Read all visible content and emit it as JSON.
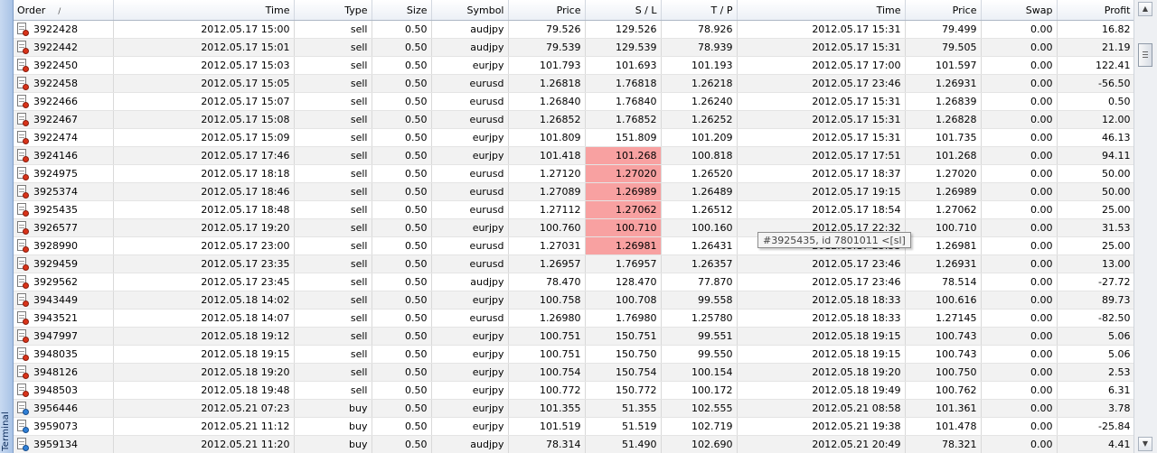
{
  "side_label": "Terminal",
  "columns": [
    "Order",
    "Time",
    "Type",
    "Size",
    "Symbol",
    "Price",
    "S / L",
    "T / P",
    "Time",
    "Price",
    "Swap",
    "Profit"
  ],
  "sort_indicator": "/",
  "tooltip": "#3925435, id 7801011  <[sl]",
  "rows": [
    {
      "order": "3922428",
      "open_time": "2012.05.17 15:00",
      "type": "sell",
      "size": "0.50",
      "symbol": "audjpy",
      "open_price": "79.526",
      "sl": "129.526",
      "tp": "78.926",
      "close_time": "2012.05.17 15:31",
      "close_price": "79.499",
      "swap": "0.00",
      "profit": "16.82",
      "sl_hit": false
    },
    {
      "order": "3922442",
      "open_time": "2012.05.17 15:01",
      "type": "sell",
      "size": "0.50",
      "symbol": "audjpy",
      "open_price": "79.539",
      "sl": "129.539",
      "tp": "78.939",
      "close_time": "2012.05.17 15:31",
      "close_price": "79.505",
      "swap": "0.00",
      "profit": "21.19",
      "sl_hit": false
    },
    {
      "order": "3922450",
      "open_time": "2012.05.17 15:03",
      "type": "sell",
      "size": "0.50",
      "symbol": "eurjpy",
      "open_price": "101.793",
      "sl": "101.693",
      "tp": "101.193",
      "close_time": "2012.05.17 17:00",
      "close_price": "101.597",
      "swap": "0.00",
      "profit": "122.41",
      "sl_hit": false
    },
    {
      "order": "3922458",
      "open_time": "2012.05.17 15:05",
      "type": "sell",
      "size": "0.50",
      "symbol": "eurusd",
      "open_price": "1.26818",
      "sl": "1.76818",
      "tp": "1.26218",
      "close_time": "2012.05.17 23:46",
      "close_price": "1.26931",
      "swap": "0.00",
      "profit": "-56.50",
      "sl_hit": false
    },
    {
      "order": "3922466",
      "open_time": "2012.05.17 15:07",
      "type": "sell",
      "size": "0.50",
      "symbol": "eurusd",
      "open_price": "1.26840",
      "sl": "1.76840",
      "tp": "1.26240",
      "close_time": "2012.05.17 15:31",
      "close_price": "1.26839",
      "swap": "0.00",
      "profit": "0.50",
      "sl_hit": false
    },
    {
      "order": "3922467",
      "open_time": "2012.05.17 15:08",
      "type": "sell",
      "size": "0.50",
      "symbol": "eurusd",
      "open_price": "1.26852",
      "sl": "1.76852",
      "tp": "1.26252",
      "close_time": "2012.05.17 15:31",
      "close_price": "1.26828",
      "swap": "0.00",
      "profit": "12.00",
      "sl_hit": false
    },
    {
      "order": "3922474",
      "open_time": "2012.05.17 15:09",
      "type": "sell",
      "size": "0.50",
      "symbol": "eurjpy",
      "open_price": "101.809",
      "sl": "151.809",
      "tp": "101.209",
      "close_time": "2012.05.17 15:31",
      "close_price": "101.735",
      "swap": "0.00",
      "profit": "46.13",
      "sl_hit": false
    },
    {
      "order": "3924146",
      "open_time": "2012.05.17 17:46",
      "type": "sell",
      "size": "0.50",
      "symbol": "eurjpy",
      "open_price": "101.418",
      "sl": "101.268",
      "tp": "100.818",
      "close_time": "2012.05.17 17:51",
      "close_price": "101.268",
      "swap": "0.00",
      "profit": "94.11",
      "sl_hit": true
    },
    {
      "order": "3924975",
      "open_time": "2012.05.17 18:18",
      "type": "sell",
      "size": "0.50",
      "symbol": "eurusd",
      "open_price": "1.27120",
      "sl": "1.27020",
      "tp": "1.26520",
      "close_time": "2012.05.17 18:37",
      "close_price": "1.27020",
      "swap": "0.00",
      "profit": "50.00",
      "sl_hit": true
    },
    {
      "order": "3925374",
      "open_time": "2012.05.17 18:46",
      "type": "sell",
      "size": "0.50",
      "symbol": "eurusd",
      "open_price": "1.27089",
      "sl": "1.26989",
      "tp": "1.26489",
      "close_time": "2012.05.17 19:15",
      "close_price": "1.26989",
      "swap": "0.00",
      "profit": "50.00",
      "sl_hit": true
    },
    {
      "order": "3925435",
      "open_time": "2012.05.17 18:48",
      "type": "sell",
      "size": "0.50",
      "symbol": "eurusd",
      "open_price": "1.27112",
      "sl": "1.27062",
      "tp": "1.26512",
      "close_time": "2012.05.17 18:54",
      "close_price": "1.27062",
      "swap": "0.00",
      "profit": "25.00",
      "sl_hit": true
    },
    {
      "order": "3926577",
      "open_time": "2012.05.17 19:20",
      "type": "sell",
      "size": "0.50",
      "symbol": "eurjpy",
      "open_price": "100.760",
      "sl": "100.710",
      "tp": "100.160",
      "close_time": "2012.05.17 22:32",
      "close_price": "100.710",
      "swap": "0.00",
      "profit": "31.53",
      "sl_hit": true
    },
    {
      "order": "3928990",
      "open_time": "2012.05.17 23:00",
      "type": "sell",
      "size": "0.50",
      "symbol": "eurusd",
      "open_price": "1.27031",
      "sl": "1.26981",
      "tp": "1.26431",
      "close_time": "2012.05.17 23:33",
      "close_price": "1.26981",
      "swap": "0.00",
      "profit": "25.00",
      "sl_hit": true
    },
    {
      "order": "3929459",
      "open_time": "2012.05.17 23:35",
      "type": "sell",
      "size": "0.50",
      "symbol": "eurusd",
      "open_price": "1.26957",
      "sl": "1.76957",
      "tp": "1.26357",
      "close_time": "2012.05.17 23:46",
      "close_price": "1.26931",
      "swap": "0.00",
      "profit": "13.00",
      "sl_hit": false
    },
    {
      "order": "3929562",
      "open_time": "2012.05.17 23:45",
      "type": "sell",
      "size": "0.50",
      "symbol": "audjpy",
      "open_price": "78.470",
      "sl": "128.470",
      "tp": "77.870",
      "close_time": "2012.05.17 23:46",
      "close_price": "78.514",
      "swap": "0.00",
      "profit": "-27.72",
      "sl_hit": false
    },
    {
      "order": "3943449",
      "open_time": "2012.05.18 14:02",
      "type": "sell",
      "size": "0.50",
      "symbol": "eurjpy",
      "open_price": "100.758",
      "sl": "100.708",
      "tp": "99.558",
      "close_time": "2012.05.18 18:33",
      "close_price": "100.616",
      "swap": "0.00",
      "profit": "89.73",
      "sl_hit": false
    },
    {
      "order": "3943521",
      "open_time": "2012.05.18 14:07",
      "type": "sell",
      "size": "0.50",
      "symbol": "eurusd",
      "open_price": "1.26980",
      "sl": "1.76980",
      "tp": "1.25780",
      "close_time": "2012.05.18 18:33",
      "close_price": "1.27145",
      "swap": "0.00",
      "profit": "-82.50",
      "sl_hit": false
    },
    {
      "order": "3947997",
      "open_time": "2012.05.18 19:12",
      "type": "sell",
      "size": "0.50",
      "symbol": "eurjpy",
      "open_price": "100.751",
      "sl": "150.751",
      "tp": "99.551",
      "close_time": "2012.05.18 19:15",
      "close_price": "100.743",
      "swap": "0.00",
      "profit": "5.06",
      "sl_hit": false
    },
    {
      "order": "3948035",
      "open_time": "2012.05.18 19:15",
      "type": "sell",
      "size": "0.50",
      "symbol": "eurjpy",
      "open_price": "100.751",
      "sl": "150.750",
      "tp": "99.550",
      "close_time": "2012.05.18 19:15",
      "close_price": "100.743",
      "swap": "0.00",
      "profit": "5.06",
      "sl_hit": false
    },
    {
      "order": "3948126",
      "open_time": "2012.05.18 19:20",
      "type": "sell",
      "size": "0.50",
      "symbol": "eurjpy",
      "open_price": "100.754",
      "sl": "150.754",
      "tp": "100.154",
      "close_time": "2012.05.18 19:20",
      "close_price": "100.750",
      "swap": "0.00",
      "profit": "2.53",
      "sl_hit": false
    },
    {
      "order": "3948503",
      "open_time": "2012.05.18 19:48",
      "type": "sell",
      "size": "0.50",
      "symbol": "eurjpy",
      "open_price": "100.772",
      "sl": "150.772",
      "tp": "100.172",
      "close_time": "2012.05.18 19:49",
      "close_price": "100.762",
      "swap": "0.00",
      "profit": "6.31",
      "sl_hit": false
    },
    {
      "order": "3956446",
      "open_time": "2012.05.21 07:23",
      "type": "buy",
      "size": "0.50",
      "symbol": "eurjpy",
      "open_price": "101.355",
      "sl": "51.355",
      "tp": "102.555",
      "close_time": "2012.05.21 08:58",
      "close_price": "101.361",
      "swap": "0.00",
      "profit": "3.78",
      "sl_hit": false
    },
    {
      "order": "3959073",
      "open_time": "2012.05.21 11:12",
      "type": "buy",
      "size": "0.50",
      "symbol": "eurjpy",
      "open_price": "101.519",
      "sl": "51.519",
      "tp": "102.719",
      "close_time": "2012.05.21 19:38",
      "close_price": "101.478",
      "swap": "0.00",
      "profit": "-25.84",
      "sl_hit": false
    },
    {
      "order": "3959134",
      "open_time": "2012.05.21 11:20",
      "type": "buy",
      "size": "0.50",
      "symbol": "audjpy",
      "open_price": "78.314",
      "sl": "51.490",
      "tp": "102.690",
      "close_time": "2012.05.21 20:49",
      "close_price": "78.321",
      "swap": "0.00",
      "profit": "4.41",
      "sl_hit": false
    }
  ]
}
